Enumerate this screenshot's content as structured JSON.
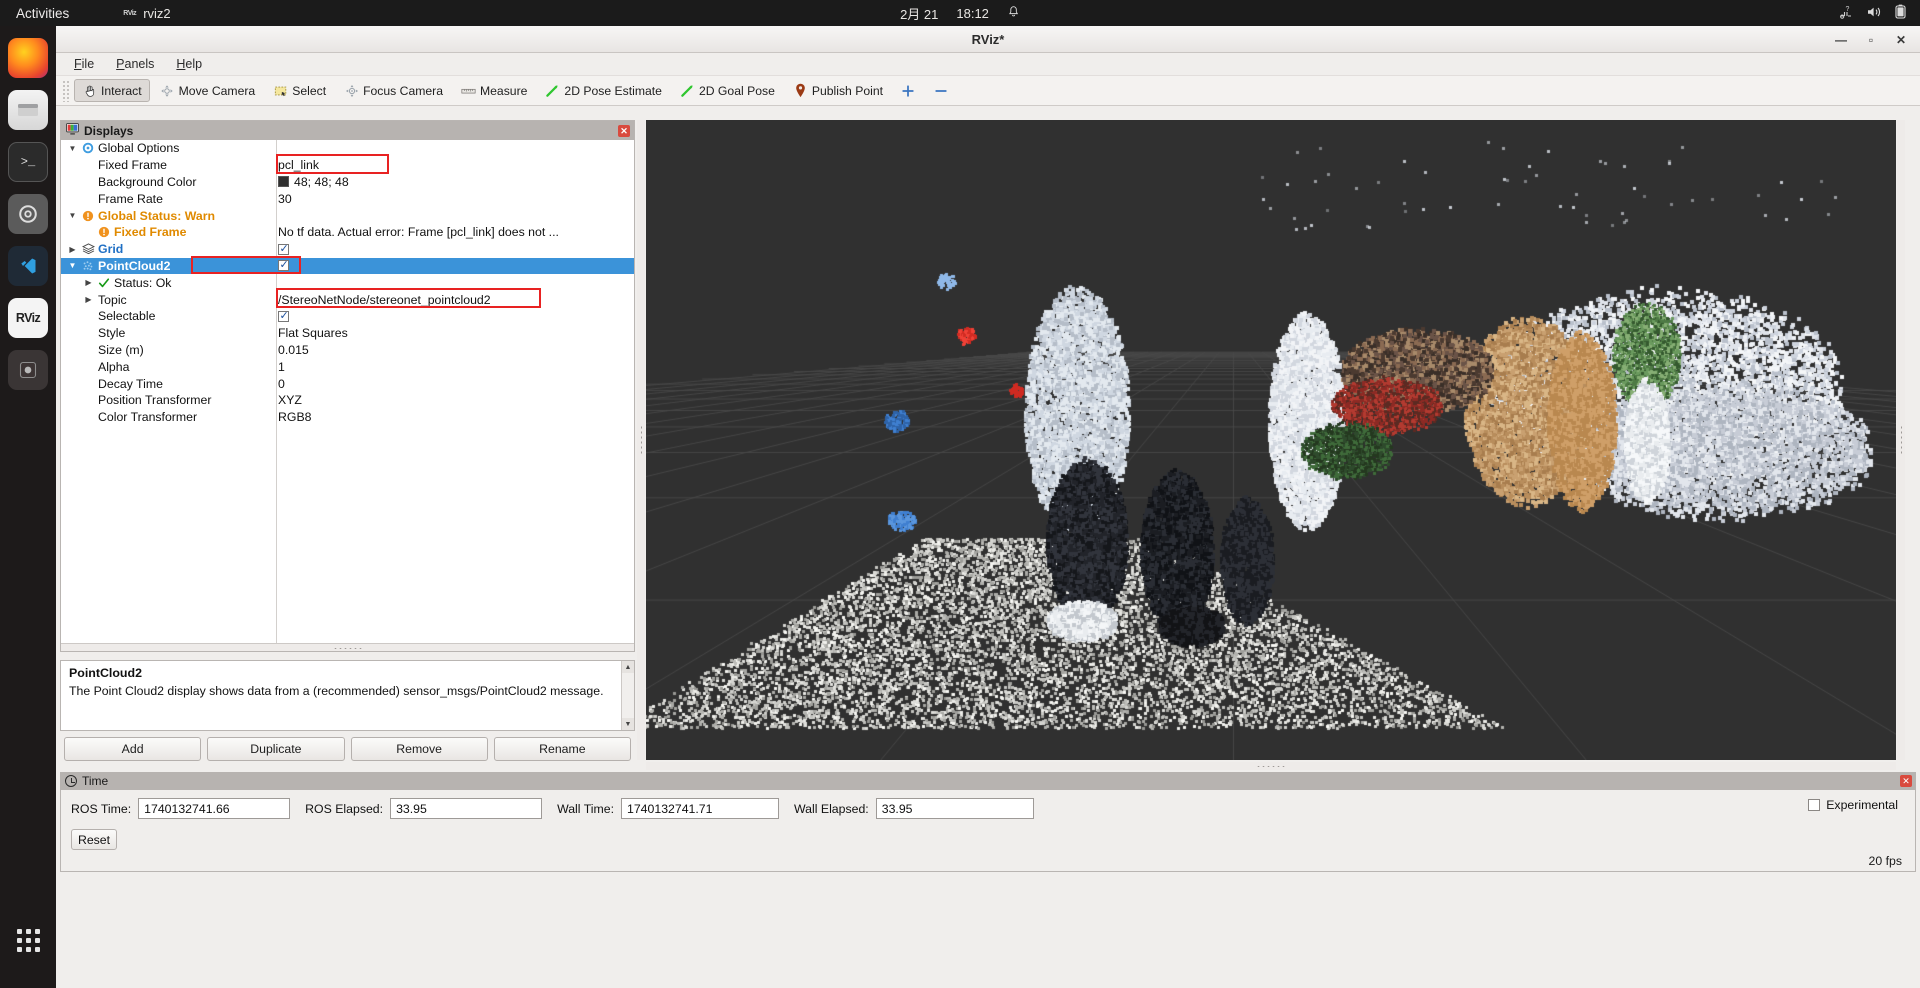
{
  "desktop": {
    "activities": "Activities",
    "app_name": "rviz2",
    "app_badge": "RViz",
    "clock_date": "2月 21",
    "clock_time": "18:12",
    "tray_icons": [
      "network-icon",
      "volume-icon",
      "battery-icon"
    ],
    "dock_items": [
      {
        "name": "firefox",
        "label": "",
        "class": "ff"
      },
      {
        "name": "files",
        "label": "",
        "class": "files"
      },
      {
        "name": "terminal",
        "label": ">_",
        "class": "term"
      },
      {
        "name": "settings",
        "label": "⚙",
        "class": "settings"
      },
      {
        "name": "vscode",
        "label": "⧩",
        "class": "vscode"
      },
      {
        "name": "rviz",
        "label": "RViz",
        "class": "rviz"
      },
      {
        "name": "ubuntu-software",
        "label": "▣",
        "class": "ubuntu"
      }
    ]
  },
  "window": {
    "title": "RViz*",
    "minimize": "—",
    "maximize": "▫",
    "close": "✕"
  },
  "menubar": [
    {
      "label": "File",
      "mnemonic": "F"
    },
    {
      "label": "Panels",
      "mnemonic": "P"
    },
    {
      "label": "Help",
      "mnemonic": "H"
    }
  ],
  "toolbar": [
    {
      "label": "Interact",
      "icon": "hand-icon",
      "active": true
    },
    {
      "label": "Move Camera",
      "icon": "move-camera-icon",
      "active": false
    },
    {
      "label": "Select",
      "icon": "select-rect-icon",
      "active": false
    },
    {
      "label": "Focus Camera",
      "icon": "focus-camera-icon",
      "active": false
    },
    {
      "label": "Measure",
      "icon": "ruler-icon",
      "active": false
    },
    {
      "label": "2D Pose Estimate",
      "icon": "pose-arrow-icon",
      "active": false
    },
    {
      "label": "2D Goal Pose",
      "icon": "goal-arrow-icon",
      "active": false
    },
    {
      "label": "Publish Point",
      "icon": "map-pin-icon",
      "active": false
    },
    {
      "label": "",
      "icon": "plus-icon",
      "active": false
    },
    {
      "label": "",
      "icon": "minus-icon",
      "active": false
    }
  ],
  "displays": {
    "panel_title": "Displays",
    "panel_icon": "displays-icon",
    "close_icon": "✕",
    "rows": [
      {
        "indent": 0,
        "arrow": "down",
        "icon": "gear-icon",
        "name": "Global Options",
        "style": "plain",
        "value_type": "none",
        "value": ""
      },
      {
        "indent": 1,
        "arrow": "blank",
        "icon": "",
        "name": "Fixed Frame",
        "style": "plain",
        "value_type": "text",
        "value": "pcl_link",
        "highlight": true
      },
      {
        "indent": 1,
        "arrow": "blank",
        "icon": "",
        "name": "Background Color",
        "style": "plain",
        "value_type": "color",
        "value": "48; 48; 48",
        "color": "#303030"
      },
      {
        "indent": 1,
        "arrow": "blank",
        "icon": "",
        "name": "Frame Rate",
        "style": "plain",
        "value_type": "text",
        "value": "30"
      },
      {
        "indent": 0,
        "arrow": "down",
        "icon": "warning-icon",
        "name": "Global Status: Warn",
        "style": "warn",
        "value_type": "none",
        "value": ""
      },
      {
        "indent": 1,
        "arrow": "blank",
        "icon": "warning-icon",
        "name": "Fixed Frame",
        "style": "warn",
        "value_type": "text",
        "value": "No tf data.  Actual error: Frame [pcl_link] does not ..."
      },
      {
        "indent": 0,
        "arrow": "right",
        "icon": "grid-icon",
        "name": "Grid",
        "style": "blue",
        "value_type": "check",
        "value": ""
      },
      {
        "indent": 0,
        "arrow": "down",
        "icon": "cloud-icon",
        "name": "PointCloud2",
        "style": "selected",
        "value_type": "check",
        "value": "",
        "highlight": true
      },
      {
        "indent": 1,
        "arrow": "right",
        "icon": "ok-icon",
        "name": "Status: Ok",
        "style": "plain",
        "value_type": "none",
        "value": ""
      },
      {
        "indent": 1,
        "arrow": "right",
        "icon": "",
        "name": "Topic",
        "style": "plain",
        "value_type": "text",
        "value": "/StereoNetNode/stereonet_pointcloud2",
        "highlight": true
      },
      {
        "indent": 1,
        "arrow": "blank",
        "icon": "",
        "name": "Selectable",
        "style": "plain",
        "value_type": "check",
        "value": ""
      },
      {
        "indent": 1,
        "arrow": "blank",
        "icon": "",
        "name": "Style",
        "style": "plain",
        "value_type": "text",
        "value": "Flat Squares"
      },
      {
        "indent": 1,
        "arrow": "blank",
        "icon": "",
        "name": "Size (m)",
        "style": "plain",
        "value_type": "text",
        "value": "0.015"
      },
      {
        "indent": 1,
        "arrow": "blank",
        "icon": "",
        "name": "Alpha",
        "style": "plain",
        "value_type": "text",
        "value": "1"
      },
      {
        "indent": 1,
        "arrow": "blank",
        "icon": "",
        "name": "Decay Time",
        "style": "plain",
        "value_type": "text",
        "value": "0"
      },
      {
        "indent": 1,
        "arrow": "blank",
        "icon": "",
        "name": "Position Transformer",
        "style": "plain",
        "value_type": "text",
        "value": "XYZ"
      },
      {
        "indent": 1,
        "arrow": "blank",
        "icon": "",
        "name": "Color Transformer",
        "style": "plain",
        "value_type": "text",
        "value": "RGB8"
      }
    ],
    "description_title": "PointCloud2",
    "description_body": "The Point Cloud2 display shows data from a (recommended) sensor_msgs/PointCloud2 message.",
    "buttons": [
      "Add",
      "Duplicate",
      "Remove",
      "Rename"
    ]
  },
  "time": {
    "panel_title": "Time",
    "panel_icon": "clock-icon",
    "close_icon": "✕",
    "fields": [
      {
        "label": "ROS Time:",
        "value": "1740132741.66"
      },
      {
        "label": "ROS Elapsed:",
        "value": "33.95"
      },
      {
        "label": "Wall Time:",
        "value": "1740132741.71"
      },
      {
        "label": "Wall Elapsed:",
        "value": "33.95"
      }
    ],
    "reset_label": "Reset",
    "experimental_label": "Experimental",
    "experimental_checked": false,
    "fps": "20 fps"
  },
  "viewport": {
    "background_color": "#303030",
    "grid_color": "#4a4a4a"
  }
}
